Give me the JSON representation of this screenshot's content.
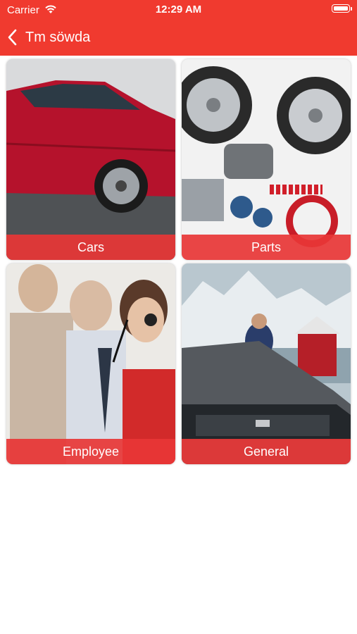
{
  "status_bar": {
    "carrier": "Carrier",
    "time": "12:29 AM"
  },
  "nav": {
    "title": "Tm söwda",
    "back_icon": "chevron-left-icon"
  },
  "theme": {
    "accent": "#f03a2f",
    "caption_bg": "#e83636"
  },
  "categories": [
    {
      "label": "Cars"
    },
    {
      "label": "Parts"
    },
    {
      "label": "Employee"
    },
    {
      "label": "General"
    }
  ]
}
